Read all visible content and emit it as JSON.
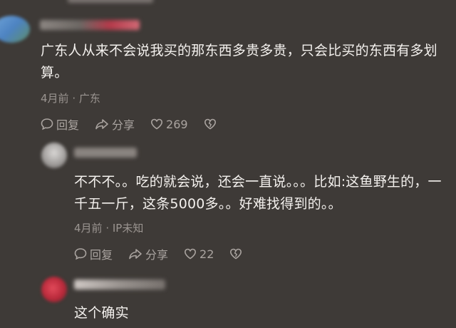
{
  "comments": [
    {
      "text": "广东人从来不会说我买的那东西多贵多贵，只会比买的东西有多划算。",
      "time": "4月前",
      "location": "广东",
      "actions": {
        "reply": "回复",
        "share": "分享",
        "likes": "269"
      }
    },
    {
      "text": "不不不。。吃的就会说，还会一直说。。。比如:这鱼野生的，一千五一斤，这条5000多。。好难找得到的。。",
      "time": "4月前",
      "location": "IP未知",
      "actions": {
        "reply": "回复",
        "share": "分享",
        "likes": "22"
      }
    },
    {
      "text": "这个确实"
    }
  ],
  "colors": {
    "background": "#3e3a37",
    "text": "#f4f1ee",
    "meta": "#9b9591"
  },
  "icons": [
    "comment-bubble-icon",
    "share-arrow-icon",
    "heart-icon",
    "broken-heart-icon"
  ]
}
